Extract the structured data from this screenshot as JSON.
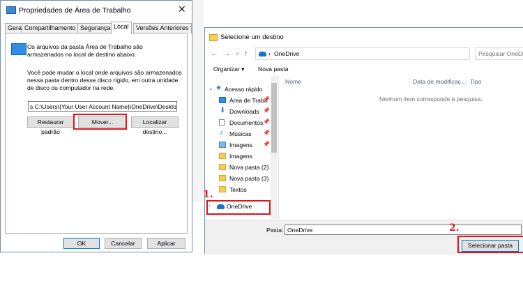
{
  "dialog1": {
    "title": "Propriedades de Área de Trabalho",
    "tabs": [
      "Geral",
      "Compartilhamento",
      "Segurança",
      "Local",
      "Versões Anteriores"
    ],
    "desc1": "Os arquivos da pasta Área de Trabalho são armazenados no local de destino abaixo.",
    "desc2": "Você pode mudar o local onde arquivos são armazenados nessa pasta dentro desse disco rígido, em outra unidade de disco ou computador na rede.",
    "path_value": "s C:\\Users\\{Your User Account Name}\\OneDrive\\Desktop",
    "btn_restore": "Restaurar padrão",
    "btn_move": "Mover...",
    "btn_locate": "Localizar destino...",
    "btn_ok": "OK",
    "btn_cancel": "Cancelar",
    "btn_apply": "Aplicar",
    "close": "✕"
  },
  "dialog2": {
    "title": "Selecione um destino",
    "address": "OneDrive",
    "search_placeholder": "Pesquisar OneDrive",
    "organize": "Organizar ▾",
    "new_folder": "Nova pasta",
    "nav": [
      {
        "label": "Acesso rápido",
        "pinned": false
      },
      {
        "label": "Área de Traba",
        "pinned": true
      },
      {
        "label": "Downloads",
        "pinned": true
      },
      {
        "label": "Documentos",
        "pinned": true
      },
      {
        "label": "Músicas",
        "pinned": true
      },
      {
        "label": "Imagens",
        "pinned": true
      },
      {
        "label": "Imagens",
        "pinned": false
      },
      {
        "label": "Nova pasta (2)",
        "pinned": false
      },
      {
        "label": "Nova pasta (3)",
        "pinned": false
      },
      {
        "label": "Textos",
        "pinned": false
      },
      {
        "label": "OneDrive",
        "pinned": false
      }
    ],
    "col_name": "Nome",
    "col_date": "Data de modificaç...",
    "col_type": "Tipo",
    "empty_text": "Nenhum item corresponde à pesquisa.",
    "folder_label": "Pasta:",
    "folder_value": "OneDrive",
    "btn_select": "Selecionar pasta"
  },
  "steps": {
    "one": "1.",
    "two": "2."
  },
  "colors": {
    "highlight": "#e1141b",
    "accent": "#0078d7"
  }
}
